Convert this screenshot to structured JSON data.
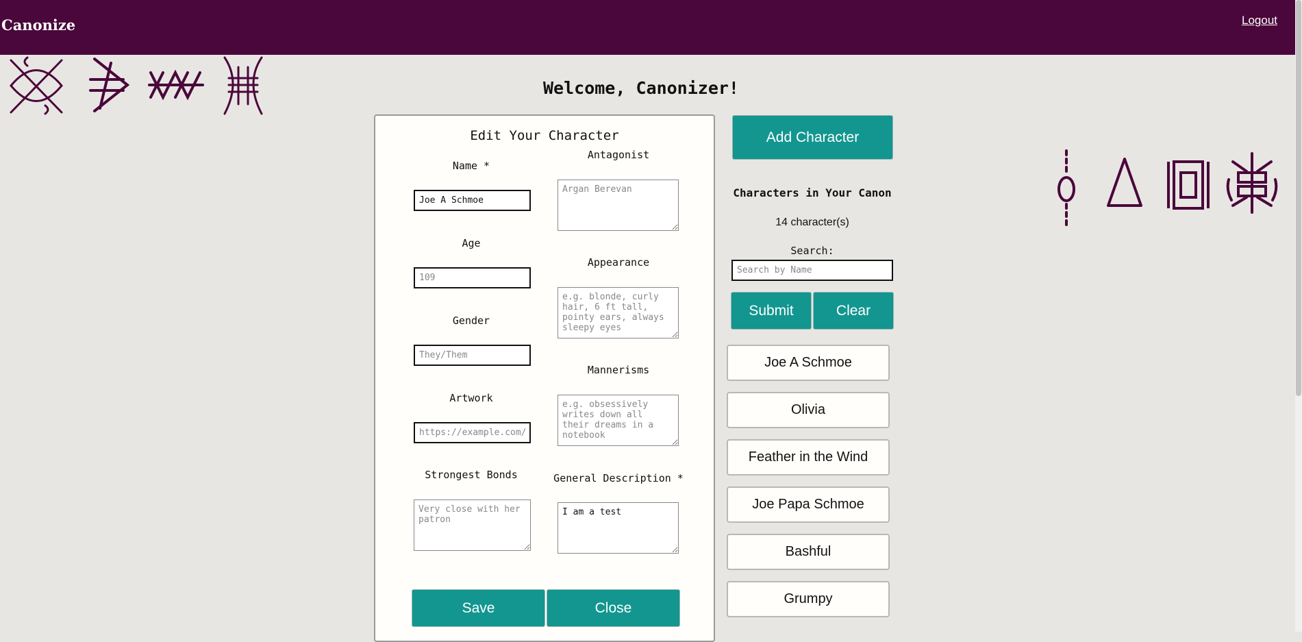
{
  "navbar": {
    "brand": "Canonize",
    "logout_label": "Logout"
  },
  "colors": {
    "navbar_bg": "#4a073b",
    "accent_teal": "#12968f",
    "page_bg": "#e8e6e3",
    "glyph": "#4a073b"
  },
  "decorations": {
    "left_glyphs": [
      "rune-x-icon",
      "rune-arrow-icon",
      "rune-zigzag-icon",
      "rune-bars-icon"
    ],
    "right_glyphs": [
      "rune-staff-icon",
      "rune-triangle-icon",
      "rune-square-icon",
      "rune-gate-icon"
    ]
  },
  "welcome": "Welcome, Canonizer!",
  "edit_form": {
    "title": "Edit Your Character",
    "name": {
      "label": "Name *",
      "value": "Joe A Schmoe"
    },
    "age": {
      "label": "Age",
      "placeholder": "109"
    },
    "gender": {
      "label": "Gender",
      "placeholder": "They/Them"
    },
    "artwork": {
      "label": "Artwork",
      "placeholder": "https://example.com/"
    },
    "bonds": {
      "label": "Strongest Bonds",
      "placeholder": "Very close with her patron"
    },
    "antagonist": {
      "label": "Antagonist",
      "placeholder": "Argan Berevan"
    },
    "appearance": {
      "label": "Appearance",
      "placeholder": "e.g. blonde, curly hair, 6 ft tall, pointy ears, always sleepy eyes"
    },
    "mannerisms": {
      "label": "Mannerisms",
      "placeholder": "e.g. obsessively writes down all their dreams in a notebook"
    },
    "description": {
      "label": "General Description *",
      "value": "I am a test"
    },
    "save_label": "Save",
    "close_label": "Close"
  },
  "sidebar": {
    "add_label": "Add Character",
    "canon_title": "Characters in Your Canon",
    "count": "14 character(s)",
    "search_label": "Search:",
    "search_placeholder": "Search by Name",
    "submit_label": "Submit",
    "clear_label": "Clear",
    "characters": [
      "Joe A Schmoe",
      "Olivia",
      "Feather in the Wind",
      "Joe Papa Schmoe",
      "Bashful",
      "Grumpy"
    ]
  }
}
